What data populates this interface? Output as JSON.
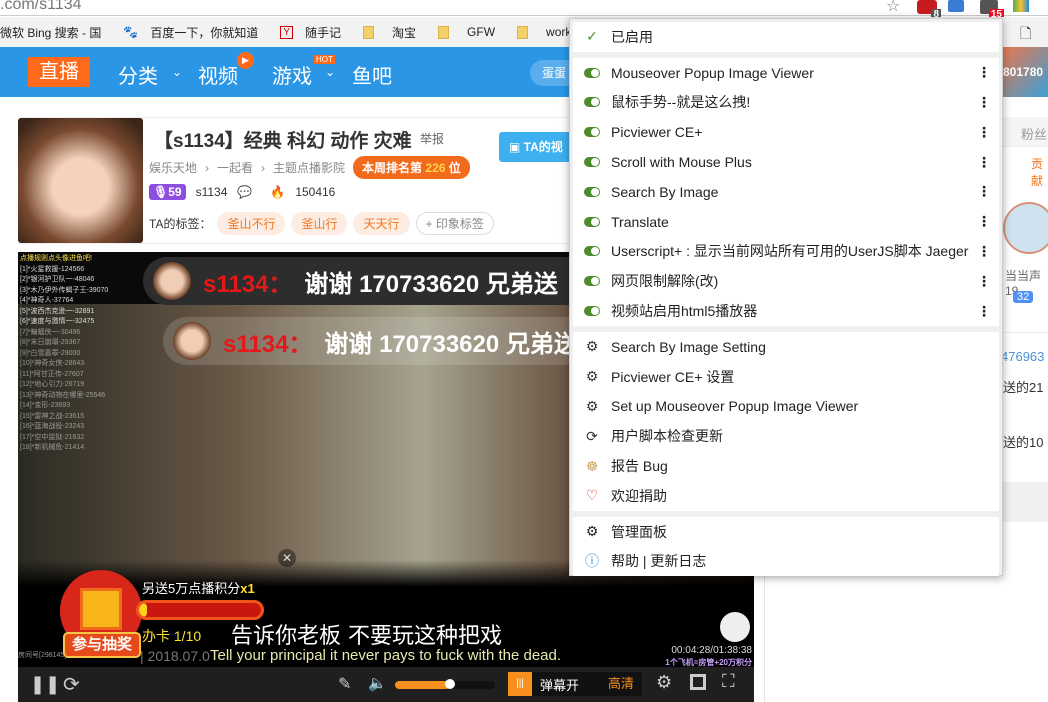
{
  "browser": {
    "url": ".com/s1134",
    "ext_badges": {
      "abp": "8",
      "tampermonkey": "15"
    },
    "bookmarks": [
      "微软 Bing 搜索 - 国",
      "百度一下，你就知道",
      "随手记",
      "淘宝",
      "GFW",
      "work"
    ]
  },
  "nav": {
    "live": "直播",
    "items": [
      "分类",
      "视频",
      "游戏",
      "鱼吧"
    ],
    "hot_badge": "HOT",
    "search_partial": "蛋蛋"
  },
  "room": {
    "title": "【s1134】经典 科幻 动作 灾难",
    "report": "举报",
    "breadcrumbs": [
      "娱乐天地",
      "一起看",
      "主题点播影院"
    ],
    "rank_prefix": "本周排名第",
    "rank": "226",
    "rank_suffix": "位",
    "level": "59",
    "owner": "s1134",
    "heat": "150416",
    "tags_label": "TA的标签：",
    "tags": [
      "釜山不行",
      "釜山行",
      "天天行"
    ],
    "add_tag": "+ 印象标签",
    "video_btn": "TA的视"
  },
  "video": {
    "rank_title": "点播规则点头像进鱼吧!",
    "rank_list": [
      "[1]*火星救援-124566",
      "[2]*银河护卫队一-48046",
      "[3]*木乃伊外传蝎子王-39070",
      "[4]*神奇人-37764",
      "[5]*波西杰克逊一-32891",
      "[6]*速度与激情一-32475",
      "[7]*蝙蝠侠一-30496",
      "[8]*末日崩塌-29367",
      "[9]*白雪嘉罪-29000",
      "[10]*神奇女侠-28643",
      "[11]*阿甘正传-27607",
      "[12]*地心引力-26719",
      "[13]*神奇动物在哪里-25546",
      "[14]*变形-23693",
      "[15]*雷神之战-23615",
      "[16]*蓝海战役-23243",
      "[17]*空中监狱-21632",
      "[18]*新机械危-21414"
    ],
    "danmu_user": "s1134：",
    "danmu_text": "谢谢 170733620 兄弟送",
    "lottery_text": "另送5万点播积分",
    "lottery_mult": "x1",
    "lottery_btn": "参与抽奖",
    "card": "办卡",
    "card_count": "1/10",
    "lottery_progress": 0.03,
    "subtitle_cn": "告诉你老板 不要玩这种把戏",
    "subtitle_en": "Tell your principal it never pays to fuck with the dead.",
    "date": "| 2018.07.0",
    "room_no": "房间号[298145]",
    "time": "00:04:28/01:38:38",
    "promo": "1个飞机=房管+20万积分",
    "danmu_toggle": "弹幕开",
    "quality": "高清",
    "volume": 0.55
  },
  "right": {
    "fans_tab": "粉丝",
    "contrib": "贡献",
    "user_partial": "当当声19",
    "badge": "32",
    "uid": "476963",
    "gift1": "送的21",
    "gift2": "送的10",
    "top_num": "801780"
  },
  "menu": {
    "enabled": "已启用",
    "scripts": [
      "Mouseover Popup Image Viewer",
      "鼠标手势--就是这么拽!",
      "Picviewer CE+",
      "Scroll with Mouse Plus",
      "Search By Image",
      "Translate",
      "Userscript+ : 显示当前网站所有可用的UserJS脚本 Jaeger",
      "网页限制解除(改)",
      "视频站启用html5播放器"
    ],
    "commands": [
      "Search By Image Setting",
      "Picviewer CE+ 设置",
      "Set up Mouseover Popup Image Viewer",
      "用户脚本检查更新",
      "报告 Bug",
      "欢迎捐助"
    ],
    "footer": [
      "管理面板",
      "帮助 | 更新日志"
    ],
    "colors": {
      "toggle": "#4c8a2a"
    }
  }
}
